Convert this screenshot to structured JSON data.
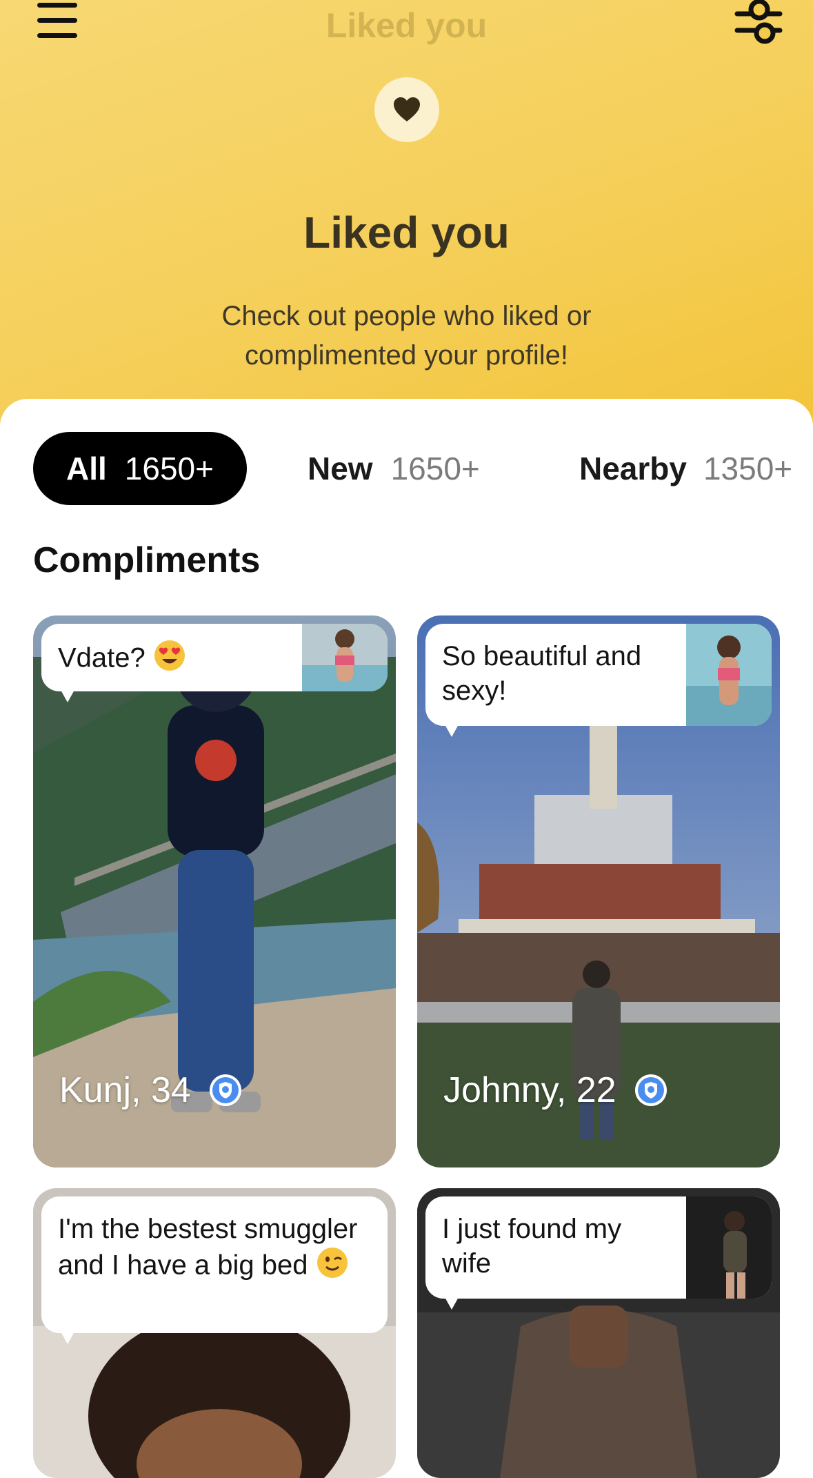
{
  "header": {
    "title": "Liked you",
    "menu_icon": "menu-icon",
    "filter_icon": "filter-sliders-icon"
  },
  "hero": {
    "badge_icon": "heart-icon",
    "title": "Liked you",
    "subtitle_line1": "Check out people who liked or",
    "subtitle_line2": "complimented your profile!",
    "background": "#f5cf5a"
  },
  "tabs": [
    {
      "label": "All",
      "count": "1650+",
      "selected": true
    },
    {
      "label": "New",
      "count": "1650+",
      "selected": false
    },
    {
      "label": "Nearby",
      "count": "1350+",
      "selected": false
    }
  ],
  "section_title": "Compliments",
  "cards": [
    {
      "name_age": "Kunj, 34",
      "compliment": "Vdate?",
      "compliment_emoji": "heart-eyes-emoji",
      "verified": true
    },
    {
      "name_age": "Johnny, 22",
      "compliment": "So beautiful and sexy!",
      "verified": true
    },
    {
      "compliment": "I'm the bestest smuggler and I have a big bed",
      "compliment_emoji": "winking-face-emoji"
    },
    {
      "compliment": "I just found my wife"
    }
  ],
  "colors": {
    "verified_badge": "#4a8df0",
    "active_tab": "#000000"
  }
}
